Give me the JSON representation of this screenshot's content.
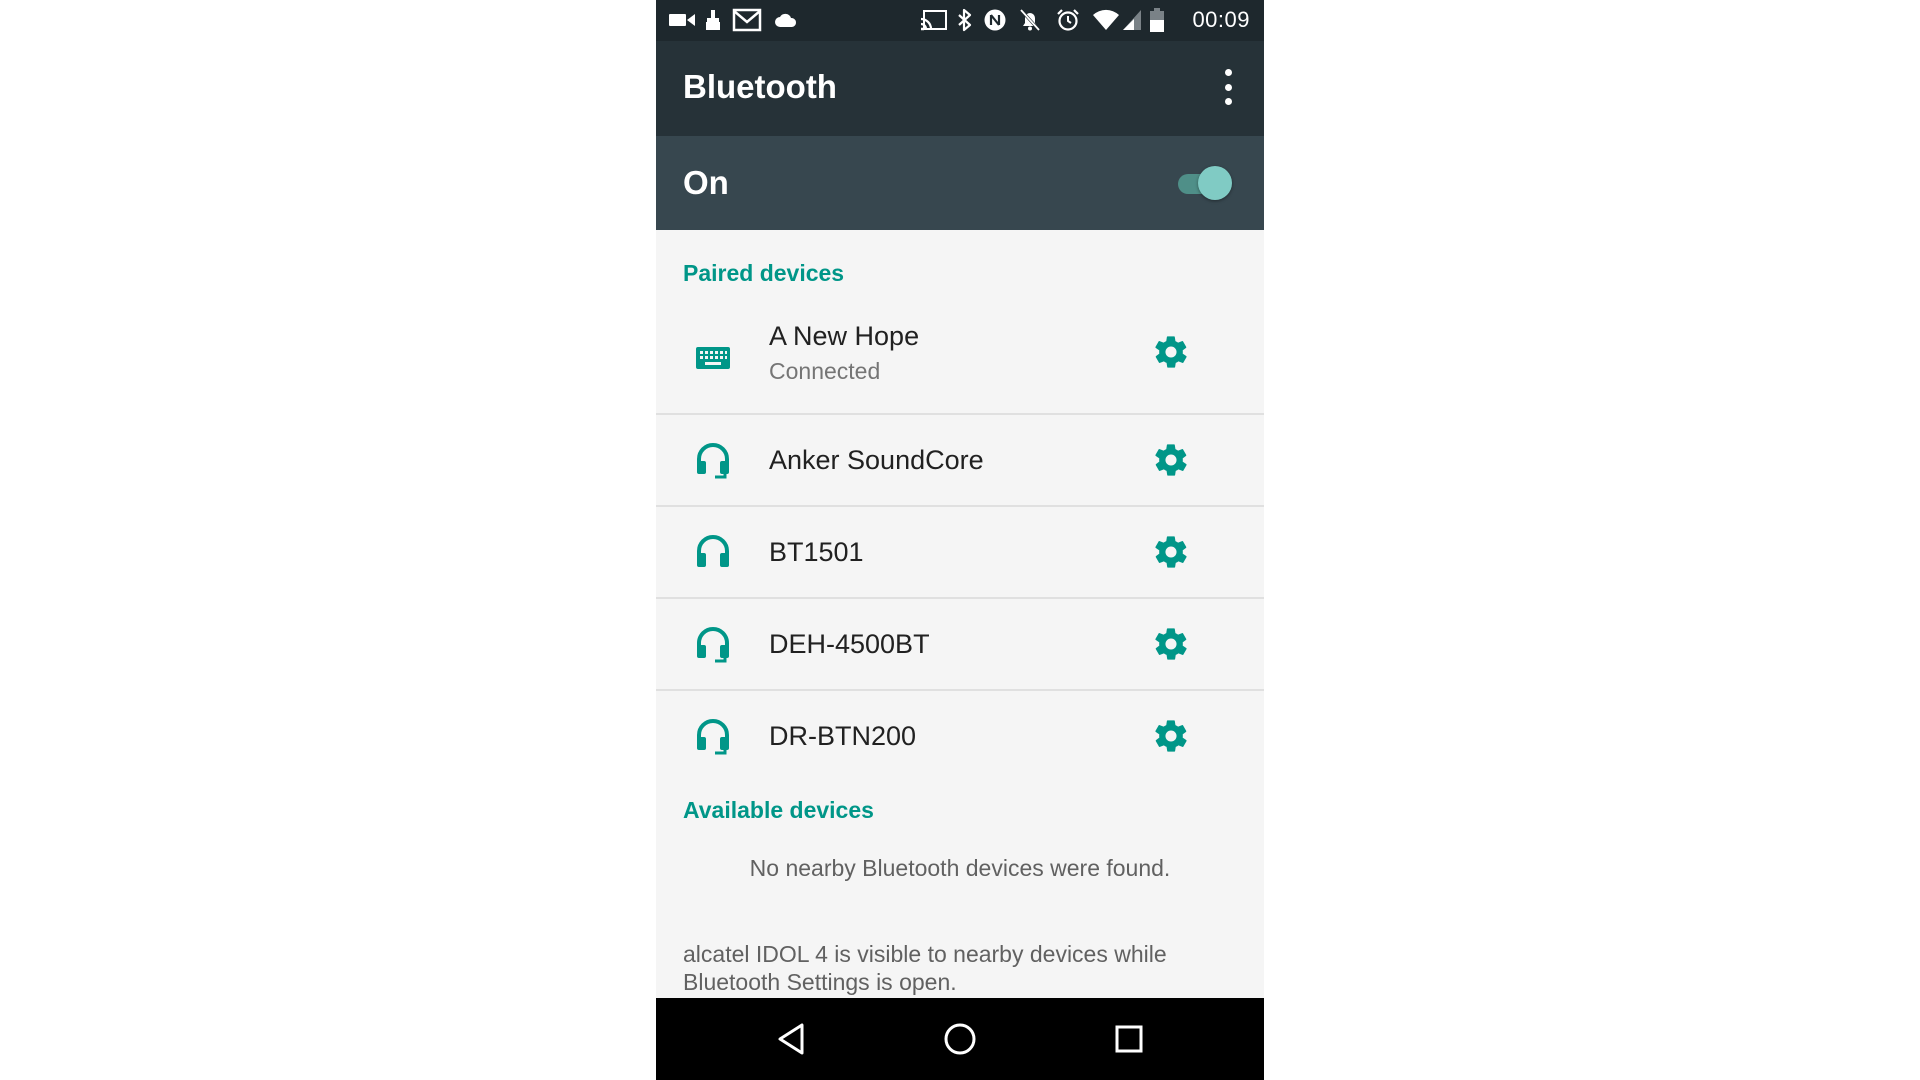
{
  "status_bar": {
    "time": "00:09",
    "icons": [
      "video-icon",
      "cleaner-icon",
      "gmail-icon",
      "cloud-icon",
      "cast-icon",
      "bluetooth-icon",
      "nfc-icon",
      "notifications-off-icon",
      "alarm-icon",
      "wifi-icon",
      "signal-icon",
      "battery-icon"
    ]
  },
  "toolbar": {
    "title": "Bluetooth",
    "overflow_icon": "more-vert-icon"
  },
  "switch_bar": {
    "label": "On",
    "checked": true
  },
  "paired": {
    "header": "Paired devices",
    "devices": [
      {
        "name": "A New Hope",
        "status": "Connected",
        "icon": "keyboard-icon"
      },
      {
        "name": "Anker SoundCore",
        "status": "",
        "icon": "headset-icon"
      },
      {
        "name": "BT1501",
        "status": "",
        "icon": "headphones-icon"
      },
      {
        "name": "DEH-4500BT",
        "status": "",
        "icon": "headset-icon"
      },
      {
        "name": "DR-BTN200",
        "status": "",
        "icon": "headset-icon"
      }
    ]
  },
  "available": {
    "header": "Available devices",
    "empty_message": "No nearby Bluetooth devices were found."
  },
  "footer_note": "alcatel IDOL 4 is visible to nearby devices while Bluetooth Settings is open.",
  "nav_bar": {
    "back_icon": "back-icon",
    "home_icon": "home-icon",
    "recents_icon": "recents-icon"
  },
  "colors": {
    "accent": "#009688",
    "toolbar": "#263238",
    "switch_bar": "#37474f",
    "status_bar": "#1e282d"
  }
}
